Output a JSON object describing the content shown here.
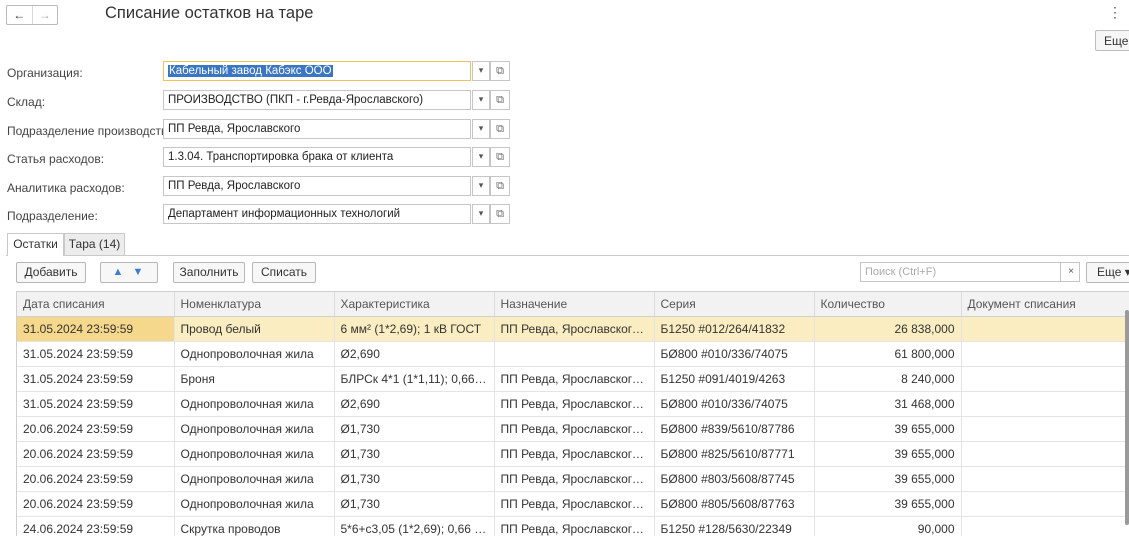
{
  "window": {
    "title": "Списание остатков на таре",
    "nav_back": "←",
    "nav_forward": "→",
    "menu_icon": "⋮",
    "more_label": "Еще"
  },
  "form": {
    "fields": [
      {
        "label": "Организация:",
        "value": "Кабельный завод Кабэкс ООО"
      },
      {
        "label": "Склад:",
        "value": "ПРОИЗВОДСТВО (ПКП - г.Ревда-Ярославского)"
      },
      {
        "label": "Подразделение производство:",
        "value": "ПП Ревда, Ярославского"
      },
      {
        "label": "Статья расходов:",
        "value": "1.3.04. Транспортировка брака от клиента"
      },
      {
        "label": "Аналитика расходов:",
        "value": "ПП Ревда, Ярославского"
      },
      {
        "label": "Подразделение:",
        "value": "Департамент информационных технологий"
      }
    ]
  },
  "tabs": [
    {
      "label": "Остатки"
    },
    {
      "label": "Тара (14)"
    }
  ],
  "toolbar": {
    "add_label": "Добавить",
    "up_icon": "▲",
    "down_icon": "▼",
    "fill_label": "Заполнить",
    "writeoff_label": "Списать",
    "search_placeholder": "Поиск (Ctrl+F)",
    "clear_icon": "×",
    "more_label": "Еще ▾"
  },
  "table": {
    "columns": [
      "Дата списания",
      "Номенклатура",
      "Характеристика",
      "Назначение",
      "Серия",
      "Количество",
      "Документ списания"
    ],
    "rows": [
      [
        "31.05.2024 23:59:59",
        "Провод белый",
        "6 мм² (1*2,69); 1 кВ ГОСТ",
        "ПП Ревда, Ярославского, ...",
        "Б1250 #012/264/41832",
        "26 838,000",
        ""
      ],
      [
        "31.05.2024 23:59:59",
        "Однопроволочная жила",
        "Ø2,690",
        "",
        "БØ800 #010/336/74075",
        "61 800,000",
        ""
      ],
      [
        "31.05.2024 23:59:59",
        "Броня",
        "БЛРСк 4*1 (1*1,11); 0,66 к...",
        "ПП Ревда, Ярославского, ...",
        "Б1250 #091/4019/4263",
        "8 240,000",
        ""
      ],
      [
        "31.05.2024 23:59:59",
        "Однопроволочная жила",
        "Ø2,690",
        "ПП Ревда, Ярославского, ...",
        "БØ800 #010/336/74075",
        "31 468,000",
        ""
      ],
      [
        "20.06.2024 23:59:59",
        "Однопроволочная жила",
        "Ø1,730",
        "ПП Ревда, Ярославского, ...",
        "БØ800 #839/5610/87786",
        "39 655,000",
        ""
      ],
      [
        "20.06.2024 23:59:59",
        "Однопроволочная жила",
        "Ø1,730",
        "ПП Ревда, Ярославского, ...",
        "БØ800 #825/5610/87771",
        "39 655,000",
        ""
      ],
      [
        "20.06.2024 23:59:59",
        "Однопроволочная жила",
        "Ø1,730",
        "ПП Ревда, Ярославского, ...",
        "БØ800 #803/5608/87745",
        "39 655,000",
        ""
      ],
      [
        "20.06.2024 23:59:59",
        "Однопроволочная жила",
        "Ø1,730",
        "ПП Ревда, Ярославского, ...",
        "БØ800 #805/5608/87763",
        "39 655,000",
        ""
      ],
      [
        "24.06.2024 23:59:59",
        "Скрутка проводов",
        "5*6+с3,05 (1*2,69); 0,66 кВ...",
        "ПП Ревда, Ярославского, ...",
        "Б1250 #128/5630/22349",
        "90,000",
        ""
      ]
    ]
  }
}
